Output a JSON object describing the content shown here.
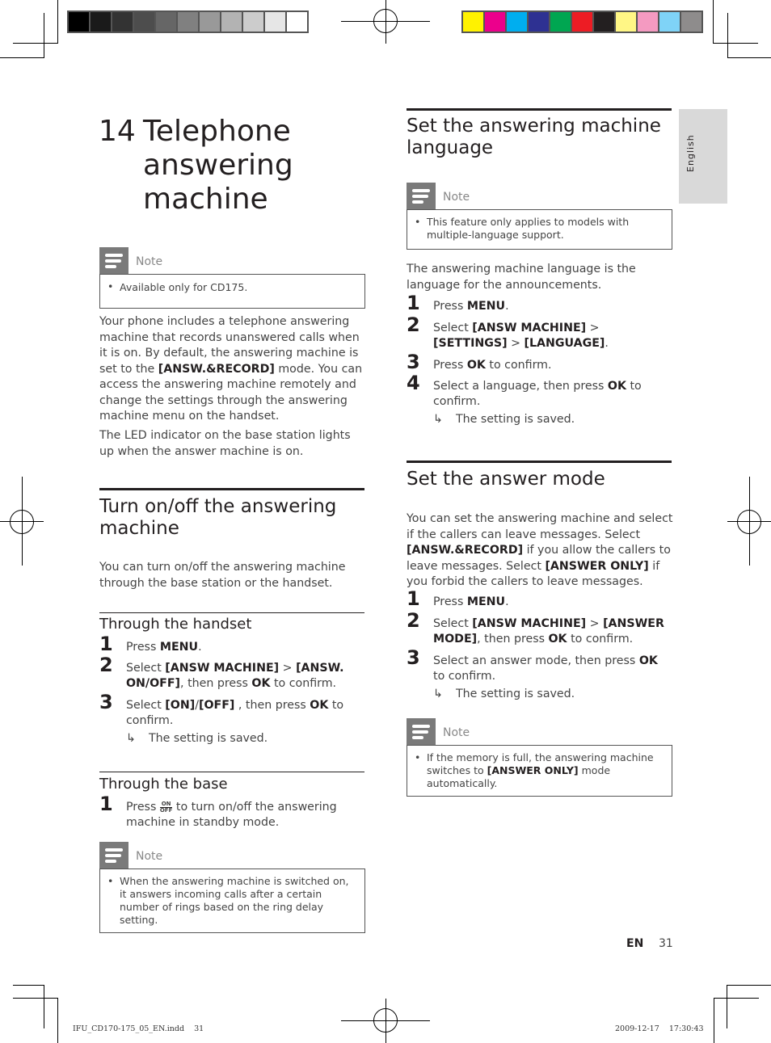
{
  "color_bars": {
    "grayscale": [
      "#000000",
      "#1a1a1a",
      "#333333",
      "#4d4d4d",
      "#666666",
      "#808080",
      "#999999",
      "#b3b3b3",
      "#cccccc",
      "#e6e6e6",
      "#ffffff"
    ],
    "process": [
      "#fff200",
      "#ec008c",
      "#00aeef",
      "#2e3192",
      "#00a651",
      "#ed1c24",
      "#231f20",
      "#fff685",
      "#f49ac1",
      "#7fd3f7",
      "#8e8c8c"
    ]
  },
  "side_tab": {
    "label": "English"
  },
  "chapter": {
    "number": "14",
    "title": "Telephone answering machine"
  },
  "left": {
    "note1": {
      "label": "Note",
      "text": "Available only for CD175."
    },
    "intro_p1_a": "Your phone includes a telephone answering machine that records unanswered calls when it is on. By default, the answering machine is set to the ",
    "intro_p1_b": "[ANSW.&RECORD]",
    "intro_p1_c": " mode. You can access the answering machine remotely and change the settings through the answering machine menu on the handset.",
    "intro_p2": "The LED indicator on the base station lights up when the answer machine is on.",
    "section_turn": {
      "title": "Turn on/off the answering machine",
      "desc": "You can turn on/off the answering machine through the base station or the handset.",
      "handset": {
        "title": "Through the handset",
        "steps": [
          {
            "n": "1",
            "a": "Press ",
            "b": "MENU",
            "c": "."
          },
          {
            "n": "2",
            "a": "Select ",
            "b": "[ANSW MACHINE]",
            "c": " > ",
            "d": "[ANSW. ON/OFF]",
            "e": ", then press ",
            "f": "OK",
            "g": " to confirm."
          },
          {
            "n": "3",
            "a": "Select ",
            "b": "[ON]",
            "c": "/",
            "d": "[OFF]",
            "e": " , then press ",
            "f": "OK",
            "g": " to confirm."
          }
        ],
        "result": "The setting is saved."
      },
      "base": {
        "title": "Through the base",
        "step": {
          "n": "1",
          "a": "Press ",
          "icon_top": "ON",
          "icon_bottom": "OFF",
          "b": " to turn on/off the answering machine in standby mode."
        }
      },
      "note": {
        "label": "Note",
        "text": "When the answering machine is switched on, it answers incoming calls after a certain number of rings based on the ring delay setting."
      }
    }
  },
  "right": {
    "section_lang": {
      "title": "Set the answering machine language",
      "note": {
        "label": "Note",
        "text": "This feature only applies to models with multiple-language support."
      },
      "desc": "The answering machine language is the language for the announcements.",
      "steps": [
        {
          "n": "1",
          "a": "Press ",
          "b": "MENU",
          "c": "."
        },
        {
          "n": "2",
          "a": "Select ",
          "b": "[ANSW MACHINE]",
          "c": " > ",
          "d": "[SETTINGS]",
          "e": " > ",
          "f": "[LANGUAGE]",
          "g": "."
        },
        {
          "n": "3",
          "a": "Press ",
          "b": "OK",
          "c": " to confirm."
        },
        {
          "n": "4",
          "a": "Select a language, then press ",
          "b": "OK",
          "c": " to confirm."
        }
      ],
      "result": "The setting is saved."
    },
    "section_mode": {
      "title": "Set the answer mode",
      "desc_a": "You can set the answering machine and select if the callers can leave messages. Select ",
      "desc_b": "[ANSW.&RECORD]",
      "desc_c": " if you allow the callers to leave messages. Select ",
      "desc_d": "[ANSWER ONLY]",
      "desc_e": " if you forbid the callers to leave messages.",
      "steps": [
        {
          "n": "1",
          "a": "Press ",
          "b": "MENU",
          "c": "."
        },
        {
          "n": "2",
          "a": "Select ",
          "b": "[ANSW MACHINE]",
          "c": " > ",
          "d": "[ANSWER MODE]",
          "e": ", then press ",
          "f": "OK",
          "g": " to confirm."
        },
        {
          "n": "3",
          "a": "Select an answer mode, then press ",
          "b": "OK",
          "c": " to confirm."
        }
      ],
      "result": "The setting is saved.",
      "note": {
        "label": "Note",
        "a": "If the memory is full, the answering machine switches to ",
        "b": "[ANSWER ONLY]",
        "c": " mode automatically."
      }
    }
  },
  "footer": {
    "lang": "EN",
    "page": "31"
  },
  "slug": {
    "file": "IFU_CD170-175_05_EN.indd",
    "page": "31",
    "date": "2009-12-17",
    "time": "17:30:43"
  },
  "result_arrow": "↳"
}
